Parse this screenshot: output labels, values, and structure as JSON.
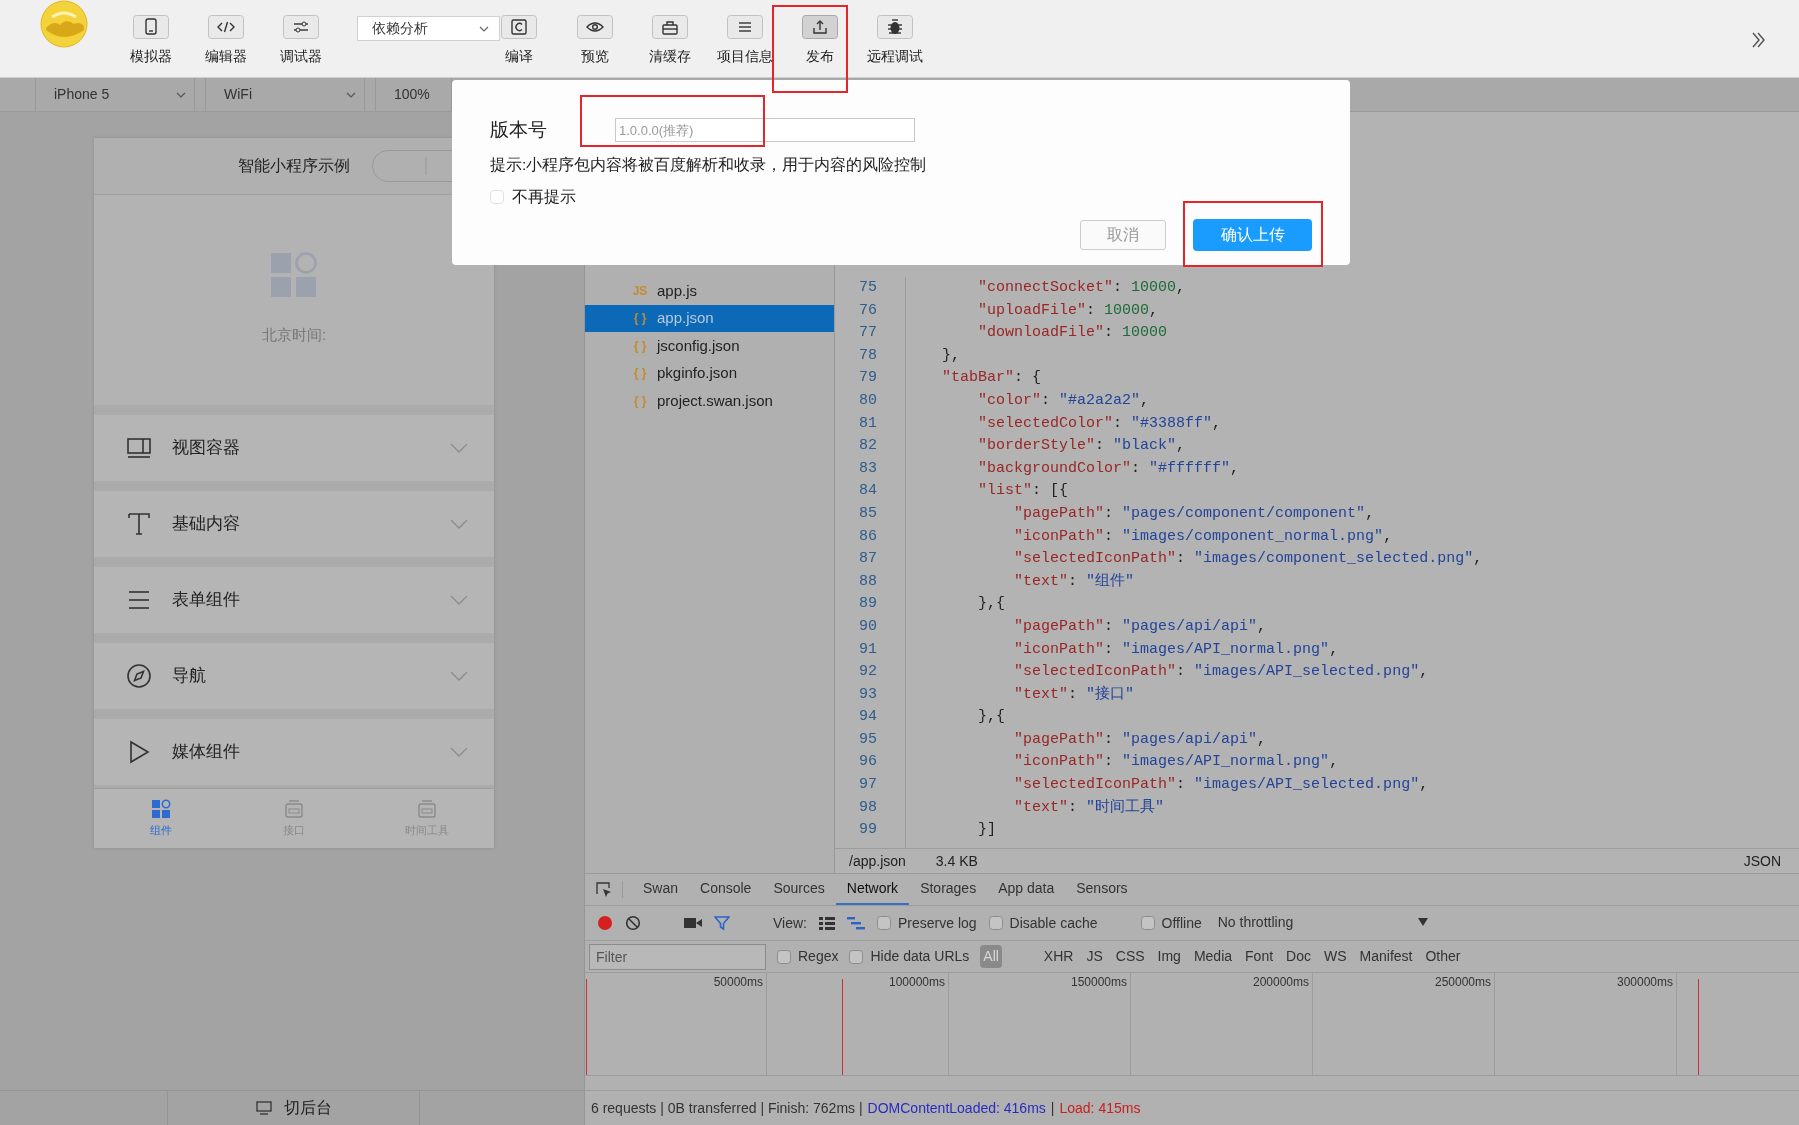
{
  "toolbar": {
    "items": [
      {
        "kind": "button",
        "label": "模拟器",
        "selected": false
      },
      {
        "kind": "button",
        "label": "编辑器",
        "selected": false
      },
      {
        "kind": "button",
        "label": "调试器",
        "selected": false
      },
      {
        "kind": "dropdown",
        "value": "依赖分析"
      },
      {
        "kind": "button",
        "label": "编译",
        "selected": false
      },
      {
        "kind": "button",
        "label": "预览",
        "selected": false
      },
      {
        "kind": "button",
        "label": "清缓存",
        "selected": false
      },
      {
        "kind": "button",
        "label": "项目信息",
        "selected": false
      },
      {
        "kind": "button",
        "label": "发布",
        "selected": true
      },
      {
        "kind": "button",
        "label": "远程调试",
        "selected": false
      }
    ]
  },
  "device_bar": {
    "device": "iPhone 5",
    "network": "WiFi",
    "zoom": "100%"
  },
  "simulator": {
    "title": "智能小程序示例",
    "time_label": "北京时间:",
    "menu": [
      {
        "label": "视图容器",
        "expanded": false
      },
      {
        "label": "基础内容",
        "expanded": false
      },
      {
        "label": "表单组件",
        "expanded": false
      },
      {
        "label": "导航",
        "expanded": false
      },
      {
        "label": "媒体组件",
        "expanded": false
      }
    ],
    "tab_bar": [
      {
        "label": "组件",
        "selected": true
      },
      {
        "label": "接口",
        "selected": false
      },
      {
        "label": "时间工具",
        "selected": false
      }
    ],
    "background_button": "切后台"
  },
  "file_tree": [
    {
      "icon": "JS",
      "name": "app.js",
      "selected": false
    },
    {
      "icon": "{ }",
      "name": "app.json",
      "selected": true
    },
    {
      "icon": "{ }",
      "name": "jsconfig.json",
      "selected": false
    },
    {
      "icon": "{ }",
      "name": "pkginfo.json",
      "selected": false
    },
    {
      "icon": "{ }",
      "name": "project.swan.json",
      "selected": false
    }
  ],
  "editor": {
    "lines": [
      {
        "number": "75",
        "code": "        \"connectSocket\": 10000,"
      },
      {
        "number": "76",
        "code": "        \"uploadFile\": 10000,"
      },
      {
        "number": "77",
        "code": "        \"downloadFile\": 10000"
      },
      {
        "number": "78",
        "code": "    },"
      },
      {
        "number": "79",
        "code": "    \"tabBar\": {"
      },
      {
        "number": "80",
        "code": "        \"color\": \"#a2a2a2\","
      },
      {
        "number": "81",
        "code": "        \"selectedColor\": \"#3388ff\","
      },
      {
        "number": "82",
        "code": "        \"borderStyle\": \"black\","
      },
      {
        "number": "83",
        "code": "        \"backgroundColor\": \"#ffffff\","
      },
      {
        "number": "84",
        "code": "        \"list\": [{"
      },
      {
        "number": "85",
        "code": "            \"pagePath\": \"pages/component/component\","
      },
      {
        "number": "86",
        "code": "            \"iconPath\": \"images/component_normal.png\","
      },
      {
        "number": "87",
        "code": "            \"selectedIconPath\": \"images/component_selected.png\","
      },
      {
        "number": "88",
        "code": "            \"text\": \"组件\""
      },
      {
        "number": "89",
        "code": "        },{"
      },
      {
        "number": "90",
        "code": "            \"pagePath\": \"pages/api/api\","
      },
      {
        "number": "91",
        "code": "            \"iconPath\": \"images/API_normal.png\","
      },
      {
        "number": "92",
        "code": "            \"selectedIconPath\": \"images/API_selected.png\","
      },
      {
        "number": "93",
        "code": "            \"text\": \"接口\""
      },
      {
        "number": "94",
        "code": "        },{"
      },
      {
        "number": "95",
        "code": "            \"pagePath\": \"pages/api/api\","
      },
      {
        "number": "96",
        "code": "            \"iconPath\": \"images/API_normal.png\","
      },
      {
        "number": "97",
        "code": "            \"selectedIconPath\": \"images/API_selected.png\","
      },
      {
        "number": "98",
        "code": "            \"text\": \"时间工具\""
      },
      {
        "number": "99",
        "code": "        }]"
      }
    ],
    "path": "/app.json",
    "size": "3.4 KB",
    "language": "JSON"
  },
  "devtools": {
    "tabs": [
      {
        "label": "Swan",
        "selected": false
      },
      {
        "label": "Console",
        "selected": false
      },
      {
        "label": "Sources",
        "selected": false
      },
      {
        "label": "Network",
        "selected": true
      },
      {
        "label": "Storages",
        "selected": false
      },
      {
        "label": "App data",
        "selected": false
      },
      {
        "label": "Sensors",
        "selected": false
      }
    ],
    "view_label": "View:",
    "options": [
      {
        "label": "Preserve log",
        "checked": false
      },
      {
        "label": "Disable cache",
        "checked": false
      },
      {
        "label": "Offline",
        "checked": false
      }
    ],
    "throttling": "No throttling",
    "filter_placeholder": "Filter",
    "filter_options": [
      {
        "label": "Regex",
        "checked": false
      },
      {
        "label": "Hide data URLs",
        "checked": false
      }
    ],
    "types": [
      {
        "label": "All",
        "selected": true
      },
      {
        "label": "XHR",
        "selected": false
      },
      {
        "label": "JS",
        "selected": false
      },
      {
        "label": "CSS",
        "selected": false
      },
      {
        "label": "Img",
        "selected": false
      },
      {
        "label": "Media",
        "selected": false
      },
      {
        "label": "Font",
        "selected": false
      },
      {
        "label": "Doc",
        "selected": false
      },
      {
        "label": "WS",
        "selected": false
      },
      {
        "label": "Manifest",
        "selected": false
      },
      {
        "label": "Other",
        "selected": false
      }
    ],
    "timeline_ticks": [
      "50000ms",
      "100000ms",
      "150000ms",
      "200000ms",
      "250000ms",
      "300000ms"
    ],
    "summary": [
      {
        "text": "6 requests | 0B transferred | Finish: 762ms |",
        "color": "#333333"
      },
      {
        "text": "DOMContentLoaded: 416ms",
        "color": "#2b2bc0"
      },
      {
        "text": "|",
        "color": "#333333"
      },
      {
        "text": "Load: 415ms",
        "color": "#c82020"
      }
    ]
  },
  "dialog": {
    "label": "版本号",
    "version_placeholder": "1.0.0.0(推荐)",
    "hint": "提示:小程序包内容将被百度解析和收录，用于内容的风险控制",
    "dont_remind": {
      "label": "不再提示",
      "checked": false
    },
    "buttons": [
      {
        "label": "取消",
        "kind": "secondary"
      },
      {
        "label": "确认上传",
        "kind": "primary"
      }
    ]
  }
}
